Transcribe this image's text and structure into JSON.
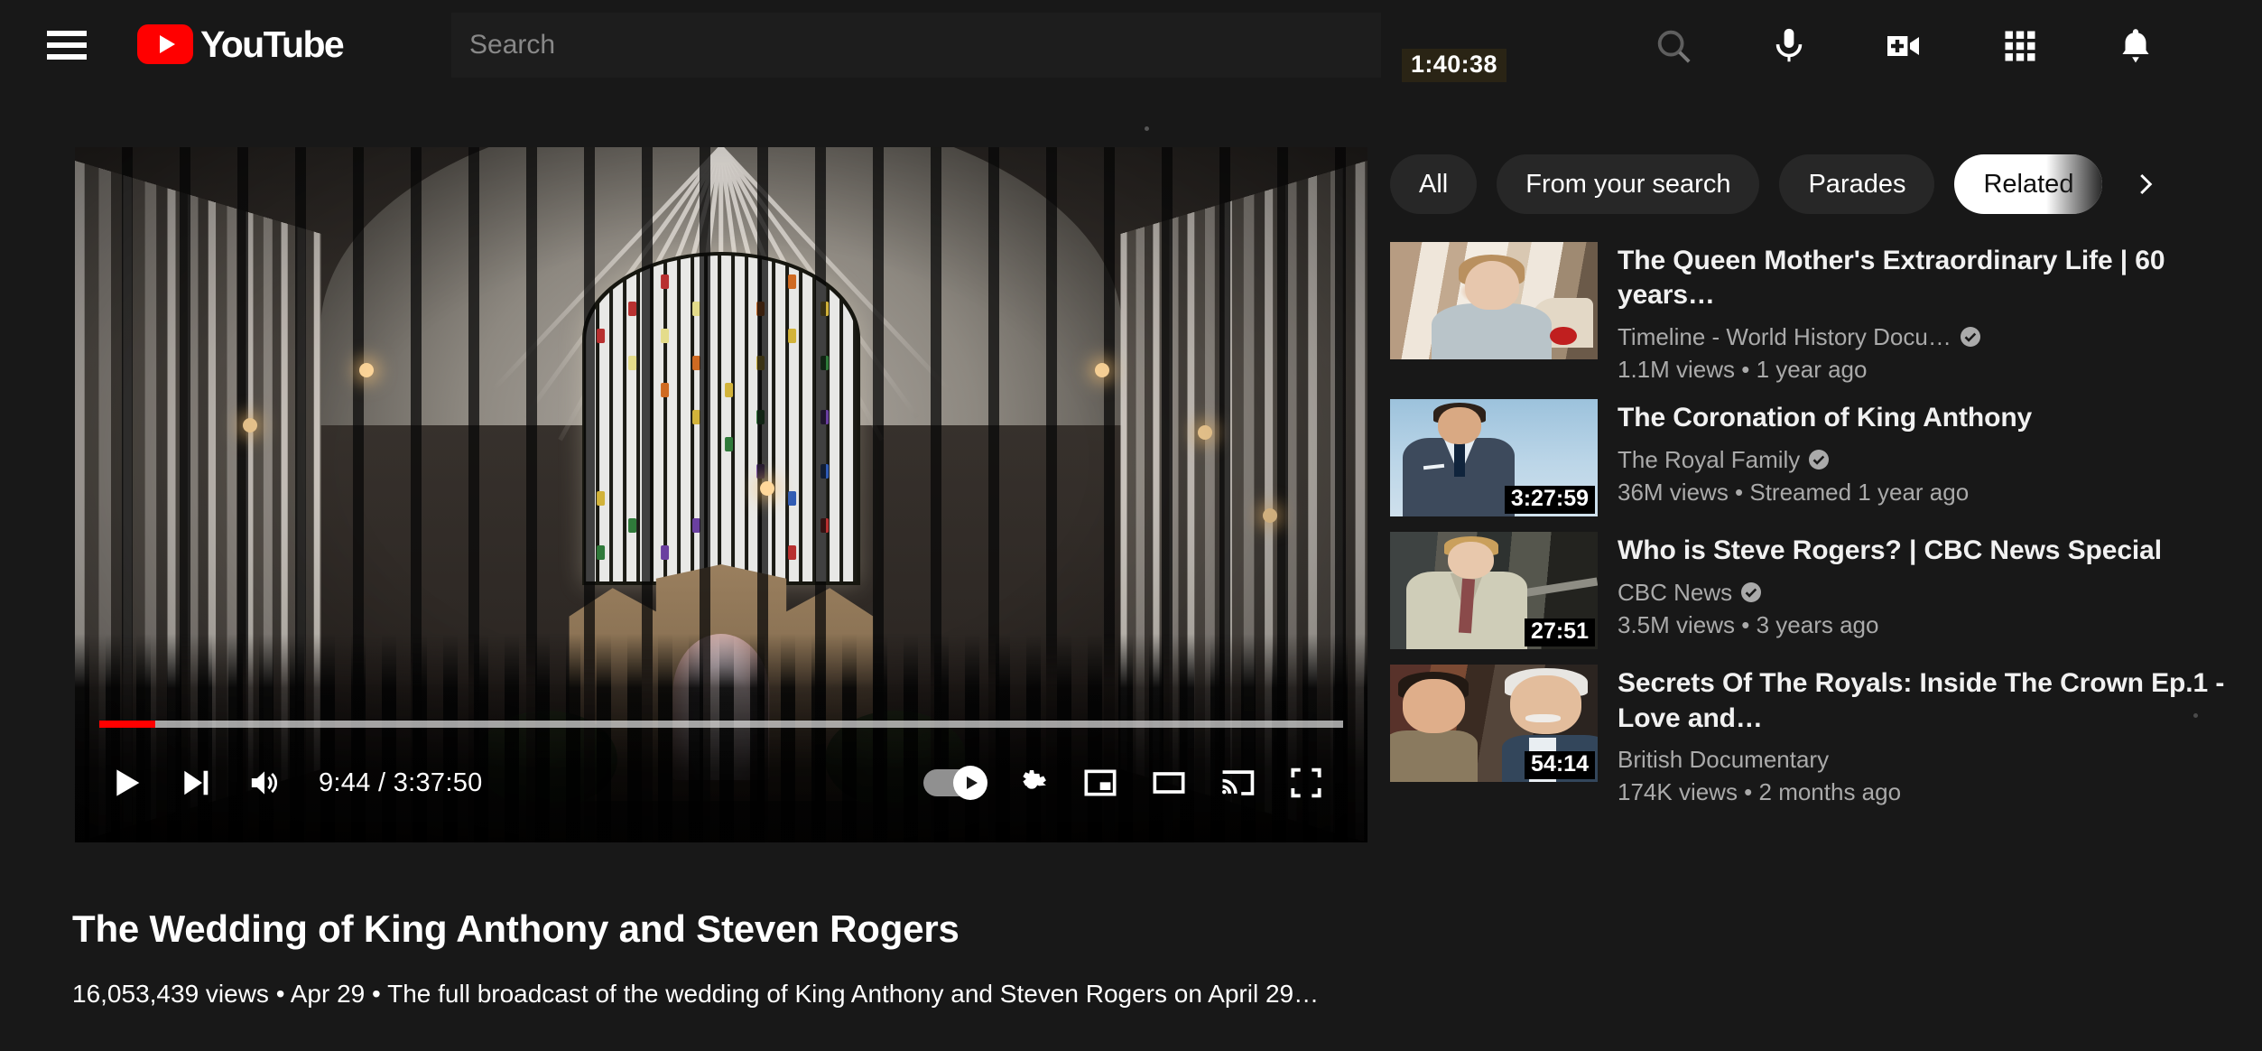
{
  "header": {
    "menu_icon": "hamburger-menu-icon",
    "logo_text": "YouTube",
    "search_placeholder": "Search",
    "search_value": "",
    "time_badge": "1:40:38",
    "icons": [
      {
        "name": "search-icon",
        "label": "Search"
      },
      {
        "name": "microphone-icon",
        "label": "Search with your voice"
      },
      {
        "name": "create-video-icon",
        "label": "Create"
      },
      {
        "name": "apps-grid-icon",
        "label": "YouTube apps"
      },
      {
        "name": "notifications-bell-icon",
        "label": "Notifications"
      }
    ]
  },
  "player": {
    "current_time": "9:44",
    "total_time": "3:37:50",
    "time_display": "9:44 / 3:37:50",
    "progress_percent": 4.5,
    "buffered_percent": 100,
    "play_state": "paused",
    "autoplay_on": true,
    "controls": [
      {
        "name": "play-button",
        "label": "Play"
      },
      {
        "name": "next-video-button",
        "label": "Next"
      },
      {
        "name": "volume-button",
        "label": "Mute"
      },
      {
        "name": "autoplay-toggle",
        "label": "Autoplay is on"
      },
      {
        "name": "settings-button",
        "label": "Settings"
      },
      {
        "name": "miniplayer-button",
        "label": "Miniplayer"
      },
      {
        "name": "theater-mode-button",
        "label": "Theater mode"
      },
      {
        "name": "cast-button",
        "label": "Play on TV"
      },
      {
        "name": "fullscreen-button",
        "label": "Full screen"
      }
    ]
  },
  "video": {
    "title": "The Wedding of King Anthony and Steven Rogers",
    "views": "16,053,439 views",
    "date": "Apr 29",
    "separator": "•",
    "description": "The full broadcast of the wedding of King Anthony and Steven Rogers on April 29…",
    "meta_line": "16,053,439 views • Apr 29 •  The full broadcast of the wedding of King Anthony and Steven Rogers on April 29…"
  },
  "rail": {
    "chips": [
      {
        "label": "All",
        "active": false
      },
      {
        "label": "From your search",
        "active": false
      },
      {
        "label": "Parades",
        "active": false
      },
      {
        "label": "Related",
        "active": true
      }
    ],
    "chip_next_icon": "chevron-right-icon",
    "videos": [
      {
        "title": "The Queen Mother's Extraordinary Life | 60 years…",
        "channel": "Timeline - World History Docu…",
        "verified": true,
        "stats": "1.1M views • 1 year ago",
        "duration": "",
        "thumb": "th-queen"
      },
      {
        "title": "The Coronation of King Anthony",
        "channel": "The Royal Family",
        "verified": true,
        "stats": "36M views • Streamed 1 year ago",
        "duration": "3:27:59",
        "thumb": "th-cor"
      },
      {
        "title": "Who is Steve Rogers? | CBC News Special",
        "channel": "CBC News",
        "verified": true,
        "stats": "3.5M views • 3 years ago",
        "duration": "27:51",
        "thumb": "th-steve"
      },
      {
        "title": "Secrets Of The Royals: Inside The Crown Ep.1 - Love and…",
        "channel": "British Documentary",
        "verified": false,
        "stats": "174K views • 2 months ago",
        "duration": "54:14",
        "thumb": "th-sec"
      }
    ]
  },
  "colors": {
    "background": "#181818",
    "brand_red": "#ff0000",
    "chip_bg": "#272727",
    "chip_active_bg": "#ffffff",
    "secondary_text": "#aaaaaa"
  }
}
